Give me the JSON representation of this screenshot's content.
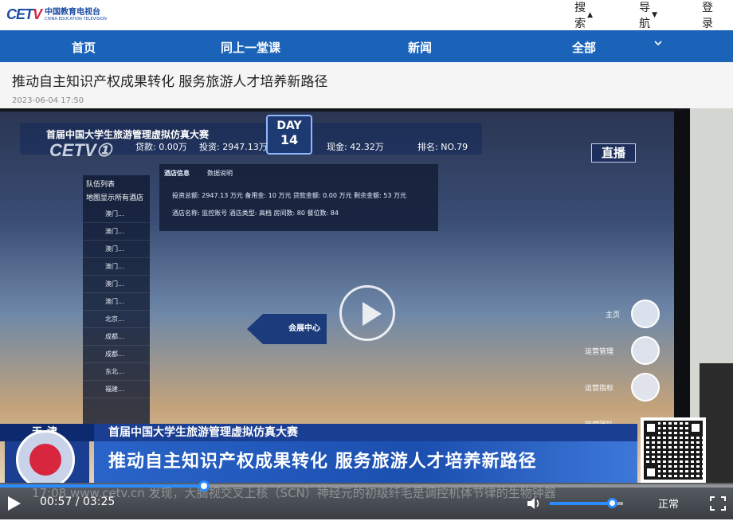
{
  "header": {
    "logo_mark_a": "CET",
    "logo_mark_b": "V",
    "logo_cn": "中国教育电视台",
    "logo_en": "CHINA EDUCATION TELEVISION",
    "search_label": "搜索",
    "nav_label": "导航",
    "login_label": "登录"
  },
  "navbar": {
    "items": [
      {
        "label": "首页"
      },
      {
        "label": "同上一堂课"
      },
      {
        "label": "新闻"
      },
      {
        "label": "全部"
      }
    ]
  },
  "article": {
    "title": "推动自主知识产权成果转化 服务旅游人才培养新路径",
    "time": "2023-06-04 17:50"
  },
  "video": {
    "screen_title": "首届中国大学生旅游管理虚拟仿真大赛",
    "day_label": "DAY",
    "day_num": "14",
    "stat_loan": "贷款: 0.00万",
    "stat_invest": "投资: 2947.13万",
    "stat_cash": "现金: 42.32万",
    "stat_rank": "排名: NO.79",
    "channel_bug": "CETV①",
    "live_badge": "直播",
    "team_list_title": "队伍列表",
    "team_list_filter": "地图显示所有酒店",
    "team_rows": [
      "澳门...",
      "澳门...",
      "澳门...",
      "澳门...",
      "澳门...",
      "澳门...",
      "北京...",
      "成都...",
      "成都...",
      "东北...",
      "福建..."
    ],
    "info_title": "酒店信息",
    "info_sub": "数据说明",
    "info_line1": "投资总额: 2947.13 万元   备用金: 10 万元   贷款金额: 0.00 万元   剩余金额: 53 万元",
    "info_line2": "酒店名称: 监控账号   酒店类型: 高档   房间数: 80   餐位数: 84",
    "map_marker": "会展中心",
    "side_menu": [
      "主页",
      "运营管理",
      "运营指标",
      "管理团队"
    ],
    "lower_third_city": "天津",
    "lower_third_sub": "首届中国大学生旅游管理虚拟仿真大赛",
    "lower_third_main": "推动自主知识产权成果转化 服务旅游人才培养新路径",
    "ticker": "17:08  www.cetv.cn  发现，大脑视交叉上核（SCN）神经元的初级纤毛是调控机体节律的生物钟器"
  },
  "player": {
    "current_time": "00:57",
    "duration": "03:25",
    "time_separator": " / ",
    "progress_fraction": 0.278,
    "volume_fraction": 0.85,
    "quality_label": "正常",
    "accent_color": "#2b8cff"
  }
}
